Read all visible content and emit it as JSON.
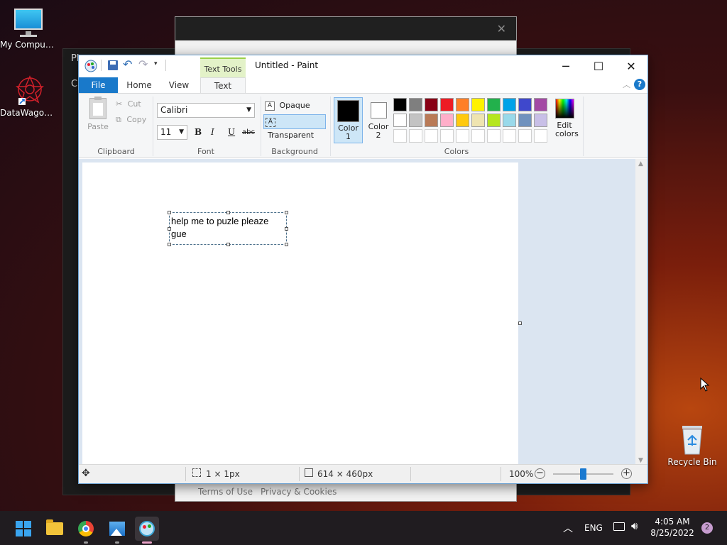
{
  "desktop": {
    "icons": [
      {
        "label": "My Computer"
      },
      {
        "label": "DataWagon..."
      },
      {
        "label": "Recycle Bin"
      }
    ]
  },
  "bg_window": {
    "partial_title": "Pl",
    "partial_tab": "C"
  },
  "browser_window": {
    "footer": {
      "terms": "Terms of Use",
      "privacy": "Privacy & Cookies"
    }
  },
  "paint": {
    "title": "Untitled - Paint",
    "context_tab": "Text Tools",
    "tabs": [
      {
        "label": "File"
      },
      {
        "label": "Home"
      },
      {
        "label": "View"
      },
      {
        "label": "Text"
      }
    ],
    "clipboard": {
      "paste": "Paste",
      "cut": "Cut",
      "copy": "Copy",
      "group": "Clipboard"
    },
    "font": {
      "family": "Calibri",
      "size": "11",
      "bold": "B",
      "italic": "I",
      "underline": "U",
      "strike": "abc",
      "group": "Font"
    },
    "background": {
      "opaque": "Opaque",
      "transparent": "Transparent",
      "group": "Background"
    },
    "colors": {
      "color1_label": "Color 1",
      "color2_label": "Color 2",
      "color1": "#000000",
      "color2": "#ffffff",
      "edit_label": "Edit colors",
      "group": "Colors",
      "row1": [
        "#000000",
        "#7f7f7f",
        "#880015",
        "#ed1c24",
        "#ff7f27",
        "#fff200",
        "#22b14c",
        "#00a2e8",
        "#3f48cc",
        "#a349a4"
      ],
      "row2": [
        "#ffffff",
        "#c3c3c3",
        "#b97a57",
        "#ffaec9",
        "#ffc90e",
        "#efe4b0",
        "#b5e61d",
        "#99d9ea",
        "#7092be",
        "#c8bfe7"
      ],
      "row3": [
        "#ffffff",
        "#ffffff",
        "#ffffff",
        "#ffffff",
        "#ffffff",
        "#ffffff",
        "#ffffff",
        "#ffffff",
        "#ffffff",
        "#ffffff"
      ]
    },
    "canvas_text_line1": "help me to puzle pleaze",
    "canvas_text_line2": "gue",
    "status": {
      "cursor": "1 × 1px",
      "size": "614 × 460px",
      "zoom": "100%"
    }
  },
  "taskbar": {
    "lang": "ENG",
    "time": "4:05 AM",
    "date": "8/25/2022",
    "notifications": "2"
  }
}
